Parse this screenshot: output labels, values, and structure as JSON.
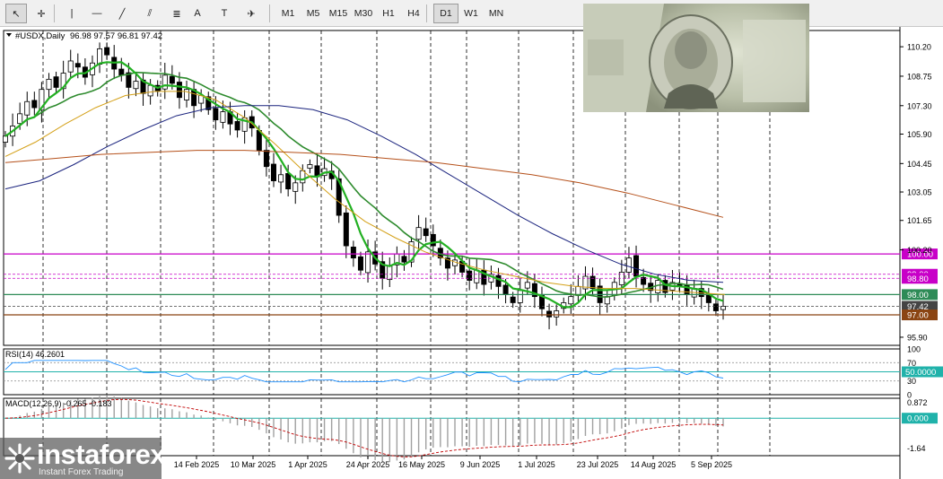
{
  "toolbar": {
    "tools": [
      {
        "name": "cursor-tool",
        "glyph": "↖"
      },
      {
        "name": "crosshair-tool",
        "glyph": "✛"
      },
      {
        "name": "vertical-line-tool",
        "glyph": "|"
      },
      {
        "name": "horizontal-line-tool",
        "glyph": "—"
      },
      {
        "name": "trendline-tool",
        "glyph": "╱"
      },
      {
        "name": "equidistant-channel-tool",
        "glyph": "⫽"
      },
      {
        "name": "fibonacci-tool",
        "glyph": "≣"
      },
      {
        "name": "text-tool",
        "glyph": "A"
      },
      {
        "name": "text-label-tool",
        "glyph": "T"
      },
      {
        "name": "shapes-tool",
        "glyph": "✈"
      }
    ],
    "timeframes": [
      "M1",
      "M5",
      "M15",
      "M30",
      "H1",
      "H4",
      "D1",
      "W1",
      "MN"
    ],
    "active_timeframe": "D1"
  },
  "logo": {
    "text": "instaforex",
    "subtitle": "Instant Forex Trading"
  },
  "chart_data": [
    {
      "type": "candlestick",
      "title": "#USDX,Daily",
      "ohlc": "96.98 97.57 96.81 97.42",
      "y_ticks": [
        110.2,
        108.75,
        107.3,
        105.9,
        104.45,
        103.05,
        101.65,
        100.2,
        95.9
      ],
      "ylim": [
        95.5,
        111.0
      ],
      "x_ticks": [
        "14 Feb 2025",
        "10 Mar 2025",
        "1 Apr 2025",
        "24 Apr 2025",
        "16 May 2025",
        "9 Jun 2025",
        "1 Jul 2025",
        "23 Jul 2025",
        "14 Aug 2025",
        "5 Sep 2025"
      ],
      "price_levels": [
        {
          "value": 100.0,
          "label": "100.00",
          "color": "#c800c8"
        },
        {
          "value": 99.0,
          "label": "99.00",
          "color": "#c800c8"
        },
        {
          "value": 98.8,
          "label": "98.80",
          "color": "#c800c8"
        },
        {
          "value": 98.0,
          "label": "98.00",
          "color": "#2e8b57"
        },
        {
          "value": 97.42,
          "label": "97.42",
          "color": "#444444"
        },
        {
          "value": 97.0,
          "label": "97.00",
          "color": "#8b4513"
        }
      ],
      "closes": [
        105.8,
        106.3,
        106.9,
        107.5,
        107.2,
        108.1,
        108.6,
        108.2,
        108.9,
        109.5,
        109.2,
        108.7,
        109.4,
        110.1,
        109.8,
        109.1,
        108.8,
        108.2,
        108.5,
        107.9,
        108.3,
        108.0,
        108.8,
        108.4,
        107.7,
        108.1,
        107.3,
        107.8,
        107.1,
        106.6,
        107.0,
        106.4,
        106.1,
        106.7,
        106.2,
        105.1,
        104.3,
        103.6,
        103.9,
        103.2,
        103.5,
        104.1,
        104.4,
        103.8,
        104.2,
        103.7,
        101.9,
        100.4,
        99.8,
        99.2,
        100.1,
        99.5,
        98.8,
        99.4,
        100.0,
        99.6,
        100.6,
        101.3,
        100.9,
        100.4,
        99.8,
        99.3,
        99.7,
        99.1,
        98.7,
        99.2,
        98.5,
        99.0,
        98.4,
        98.0,
        97.6,
        98.2,
        98.6,
        97.9,
        97.3,
        96.9,
        97.2,
        97.6,
        97.9,
        98.4,
        98.9,
        98.3,
        97.6,
        97.9,
        98.6,
        99.1,
        99.8,
        98.9,
        98.5,
        98.2,
        98.7,
        98.1,
        98.6,
        98.4,
        98.0,
        98.3,
        97.9,
        97.6,
        97.2,
        97.42
      ],
      "ma_period_fast": 5,
      "ma_period_slow": 14,
      "long_ma_yellow": [
        104.8,
        105.5,
        106.4,
        107.2,
        107.8,
        108.0,
        108.0,
        107.6,
        106.7,
        105.4,
        104.0,
        102.7,
        101.6,
        100.8,
        100.1,
        99.6,
        99.2,
        98.9,
        98.6,
        98.4,
        98.3,
        98.3,
        98.2,
        98.1,
        98.0
      ],
      "long_ma_navy": [
        103.2,
        103.6,
        104.4,
        105.3,
        106.1,
        106.8,
        107.2,
        107.3,
        107.3,
        107.1,
        106.6,
        105.8,
        104.9,
        103.9,
        102.9,
        101.9,
        101.0,
        100.2,
        99.5,
        99.0,
        98.7,
        98.6
      ],
      "long_ma_brown": [
        104.5,
        104.7,
        104.9,
        105.0,
        105.1,
        105.1,
        105.0,
        104.9,
        104.7,
        104.5,
        104.2,
        103.9,
        103.5,
        103.0,
        102.4,
        101.8
      ],
      "rsi": {
        "label": "RSI(14) 46.2601",
        "period": 14,
        "value": 46.2601,
        "ylim": [
          0,
          100
        ],
        "ticks": [
          100,
          70,
          30,
          0
        ],
        "level_box": "50.0000",
        "level": 50,
        "color": "#1e90ff"
      },
      "macd": {
        "label": "MACD(12,26,9) -0.265 -0.183",
        "params": "12,26,9",
        "main": -0.265,
        "signal": -0.183,
        "ylim": [
          -1.64,
          0.872
        ],
        "ticks": [
          0.872,
          -1.64
        ],
        "zero_box": "0.000"
      }
    }
  ]
}
